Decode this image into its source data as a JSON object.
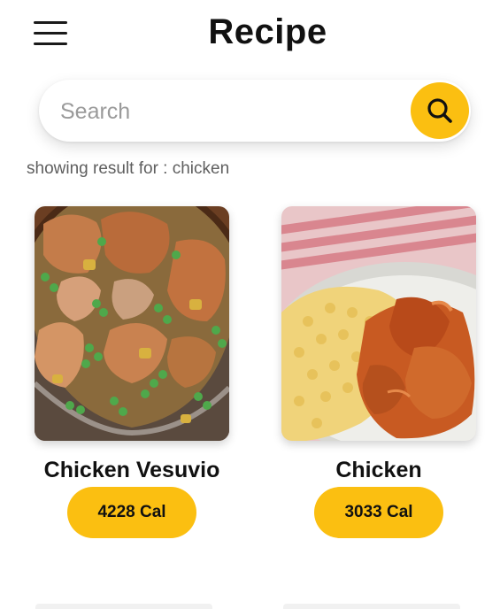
{
  "app": {
    "title": "Recipe"
  },
  "header": {
    "menu_icon": "hamburger-menu-icon"
  },
  "search": {
    "value": "",
    "placeholder": "Search",
    "button_icon": "search-icon"
  },
  "results": {
    "label": "showing result for : chicken"
  },
  "recipes": [
    {
      "title": "Chicken Vesuvio",
      "calories": "4228 Cal",
      "image": "chicken-vesuvio-photo"
    },
    {
      "title": "Chicken",
      "calories": "3033 Cal",
      "image": "chicken-with-spaetzle-photo"
    }
  ],
  "colors": {
    "accent": "#fbbf11",
    "title_text": "#111111",
    "muted_text": "#5f5f5f",
    "placeholder_text": "#9a9a9a",
    "background": "#ffffff"
  }
}
